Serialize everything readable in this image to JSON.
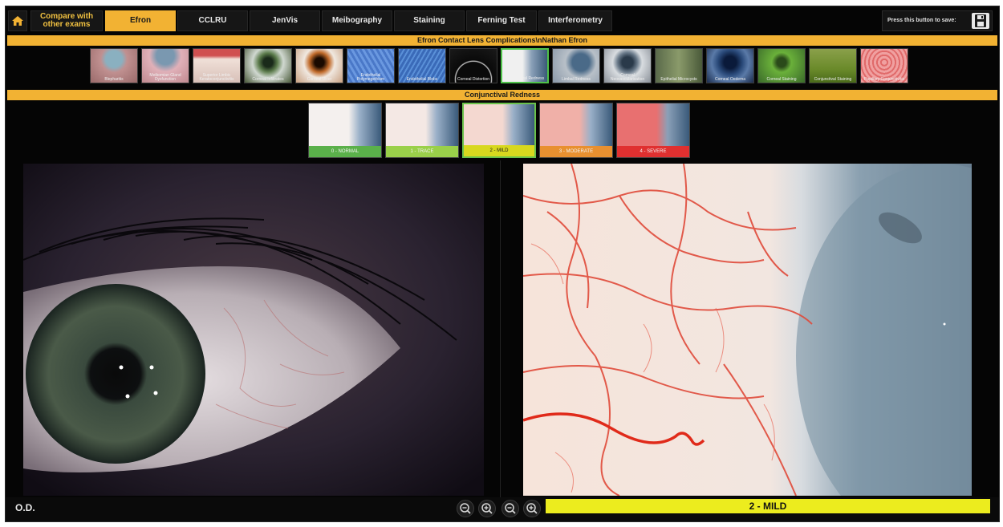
{
  "nav": {
    "compare_label": "Compare with other exams",
    "tabs": [
      {
        "label": "Efron",
        "active": true
      },
      {
        "label": "CCLRU",
        "active": false
      },
      {
        "label": "JenVis",
        "active": false
      },
      {
        "label": "Meibography",
        "active": false
      },
      {
        "label": "Staining",
        "active": false
      },
      {
        "label": "Ferning Test",
        "active": false
      },
      {
        "label": "Interferometry",
        "active": false
      }
    ],
    "save_prompt": "Press this button to save:"
  },
  "complications": {
    "title": "Efron Contact Lens Complications\\nNathan Efron",
    "selected": "Conjunctival Redness",
    "items": [
      {
        "label": "Blepharitis",
        "color": "#b07a7a"
      },
      {
        "label": "Meibomian Gland Dysfunction",
        "color": "#c08a8a"
      },
      {
        "label": "Superior Limbic Keratoconjunctivitis",
        "color": "#d8c0b8"
      },
      {
        "label": "Corneal Infiltrates",
        "color": "#5a6a4a"
      },
      {
        "label": "Corneal Ulcer",
        "color": "#c06a3a"
      },
      {
        "label": "Endothelial Polymegethism",
        "color": "#5a8ad0"
      },
      {
        "label": "Endothelial Blebs",
        "color": "#4a7ac8"
      },
      {
        "label": "Corneal Distortion",
        "color": "#2a2a2a"
      },
      {
        "label": "Conjunctival Redness",
        "color": "#c8d0d8"
      },
      {
        "label": "Limbal Redness",
        "color": "#8a9aa8"
      },
      {
        "label": "Corneal Neovascularisation",
        "color": "#9aa0a8"
      },
      {
        "label": "Epithelial Microcysts",
        "color": "#6a7a5a"
      },
      {
        "label": "Corneal Oedema",
        "color": "#3a5a8a"
      },
      {
        "label": "Corneal Staining",
        "color": "#5a8a3a"
      },
      {
        "label": "Conjunctival Staining",
        "color": "#6a8a3a"
      },
      {
        "label": "Papillary Conjunctivitis",
        "color": "#e07070"
      }
    ]
  },
  "redness": {
    "title": "Conjunctival Redness",
    "selected_grade": "2 - MILD",
    "grades": [
      {
        "label": "0 - NORMAL",
        "band": "#5ab04a"
      },
      {
        "label": "1 - TRACE",
        "band": "#9ad04a"
      },
      {
        "label": "2 - MILD",
        "band": "#d8d81e"
      },
      {
        "label": "3 - MODERATE",
        "band": "#e89030"
      },
      {
        "label": "4 - SEVERE",
        "band": "#e03030"
      }
    ]
  },
  "bottom": {
    "eye_side": "O.D.",
    "grade_display": "2 - MILD"
  },
  "colors": {
    "accent": "#f2b233",
    "grade_highlight": "#ecec1e",
    "selection": "#4fc24a"
  }
}
